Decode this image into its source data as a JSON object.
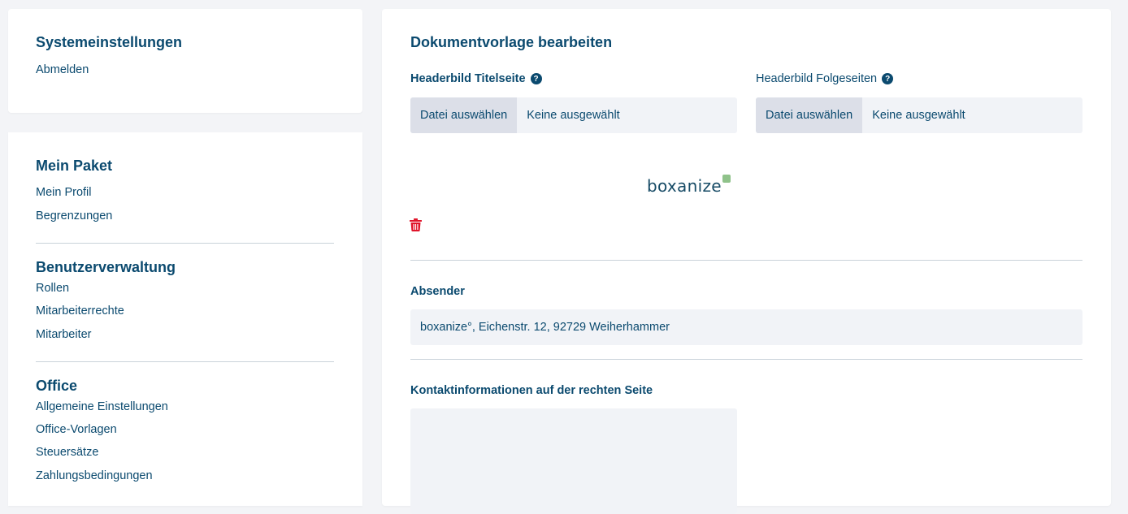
{
  "sidebar": {
    "system_section": {
      "title": "Systemeinstellungen",
      "items": [
        "Abmelden"
      ]
    },
    "package_section": {
      "title": "Mein Paket",
      "items": [
        "Mein Profil",
        "Begrenzungen"
      ]
    },
    "user_section": {
      "title": "Benutzerverwaltung",
      "items": [
        "Rollen",
        "Mitarbeiterrechte",
        "Mitarbeiter"
      ]
    },
    "office_section": {
      "title": "Office",
      "items": [
        "Allgemeine Einstellungen",
        "Office-Vorlagen",
        "Steuersätze",
        "Zahlungsbedingungen"
      ]
    }
  },
  "main": {
    "title": "Dokumentvorlage bearbeiten",
    "header_title_page": {
      "label": "Headerbild Titelseite",
      "button": "Datei auswählen",
      "status": "Keine ausgewählt"
    },
    "header_follow_pages": {
      "label": "Headerbild Folgeseiten",
      "button": "Datei auswählen",
      "status": "Keine ausgewählt"
    },
    "logo_text": "boxanize",
    "sender": {
      "label": "Absender",
      "value": "boxanize°, Eichenstr. 12, 92729 Weiherhammer"
    },
    "contact": {
      "label": "Kontaktinformationen auf der rechten Seite",
      "value": ""
    },
    "help_glyph": "?",
    "colors": {
      "primary": "#0b4a6f",
      "delete": "#e0152b",
      "logo_accent": "#8fc28a"
    }
  }
}
